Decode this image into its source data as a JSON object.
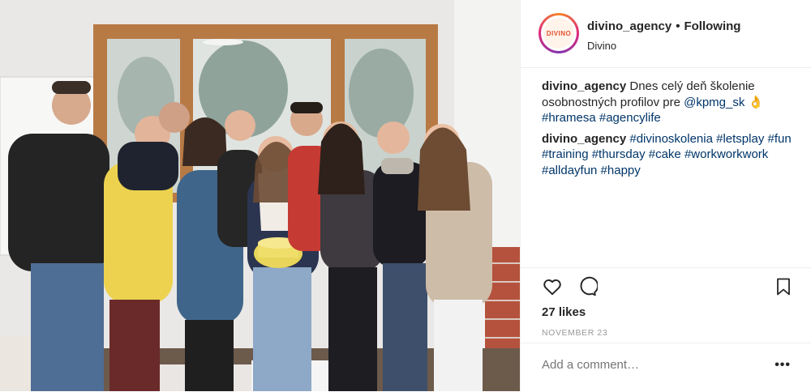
{
  "header": {
    "username": "divino_agency",
    "separator": "•",
    "follow_status": "Following",
    "location": "Divino",
    "avatar_text": "DIVINO"
  },
  "comments": [
    {
      "user": "divino_agency",
      "text": "Dnes celý deň školenie osobnostných profilov pre ",
      "mention": "@kpmg_sk",
      "emoji": "👌",
      "tags": "#hramesa #agencylife"
    },
    {
      "user": "divino_agency",
      "tags": "#divinoskolenia #letsplay #fun #training #thursday #cake #workworkwork #alldayfun #happy"
    }
  ],
  "actions": {
    "like_icon": "heart-icon",
    "comment_icon": "comment-icon",
    "save_icon": "bookmark-icon"
  },
  "likes": "27 likes",
  "date": "NOVEMBER 23",
  "add_comment": {
    "placeholder": "Add a comment…",
    "more": "•••"
  },
  "colors": {
    "text": "#262626",
    "link": "#003569",
    "muted": "#999999",
    "divider": "#efefef"
  }
}
